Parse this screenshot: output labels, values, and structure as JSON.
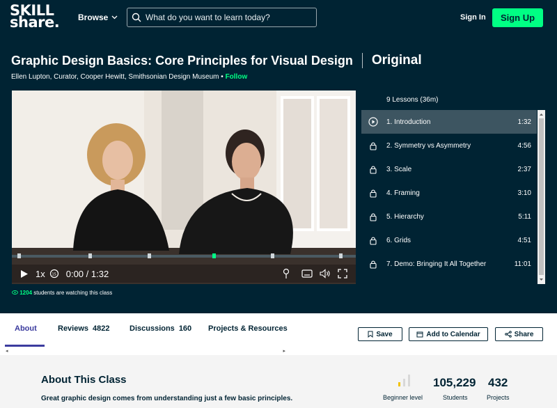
{
  "header": {
    "logo_line1": "SKILL",
    "logo_line2": "share.",
    "browse_label": "Browse",
    "search_placeholder": "What do you want to learn today?",
    "signin_label": "Sign In",
    "signup_label": "Sign Up"
  },
  "course": {
    "title": "Graphic Design Basics: Core Principles for Visual Design",
    "badge": "Original",
    "author": "Ellen Lupton, Curator, Cooper Hewitt, Smithsonian Design Museum",
    "bullet": "•",
    "follow_label": "Follow"
  },
  "player": {
    "speed": "1x",
    "time": "0:00 / 1:32",
    "watching_count": "1204",
    "watching_text": "students are watching this class"
  },
  "lessons": {
    "header": "9 Lessons (36m)",
    "items": [
      {
        "label": "1. Introduction",
        "duration": "1:32",
        "active": true
      },
      {
        "label": "2. Symmetry vs Asymmetry",
        "duration": "4:56"
      },
      {
        "label": "3. Scale",
        "duration": "2:37"
      },
      {
        "label": "4. Framing",
        "duration": "3:10"
      },
      {
        "label": "5. Hierarchy",
        "duration": "5:11"
      },
      {
        "label": "6. Grids",
        "duration": "4:51"
      },
      {
        "label": "7. Demo: Bringing It All Together",
        "duration": "11:01"
      }
    ]
  },
  "tabs": {
    "about": "About",
    "reviews": "Reviews",
    "reviews_count": "4822",
    "discussions": "Discussions",
    "discussions_count": "160",
    "projects": "Projects & Resources"
  },
  "actions": {
    "save": "Save",
    "calendar": "Add to Calendar",
    "share": "Share"
  },
  "about": {
    "title": "About This Class",
    "text": "Great graphic design comes from understanding just a few basic principles.",
    "level": "Beginner level",
    "students_num": "105,229",
    "students_label": "Students",
    "projects_num": "432",
    "projects_label": "Projects"
  },
  "colors": {
    "brand_bg": "#002333",
    "accent_green": "#00ff84",
    "tab_active": "#3b3b9e"
  }
}
